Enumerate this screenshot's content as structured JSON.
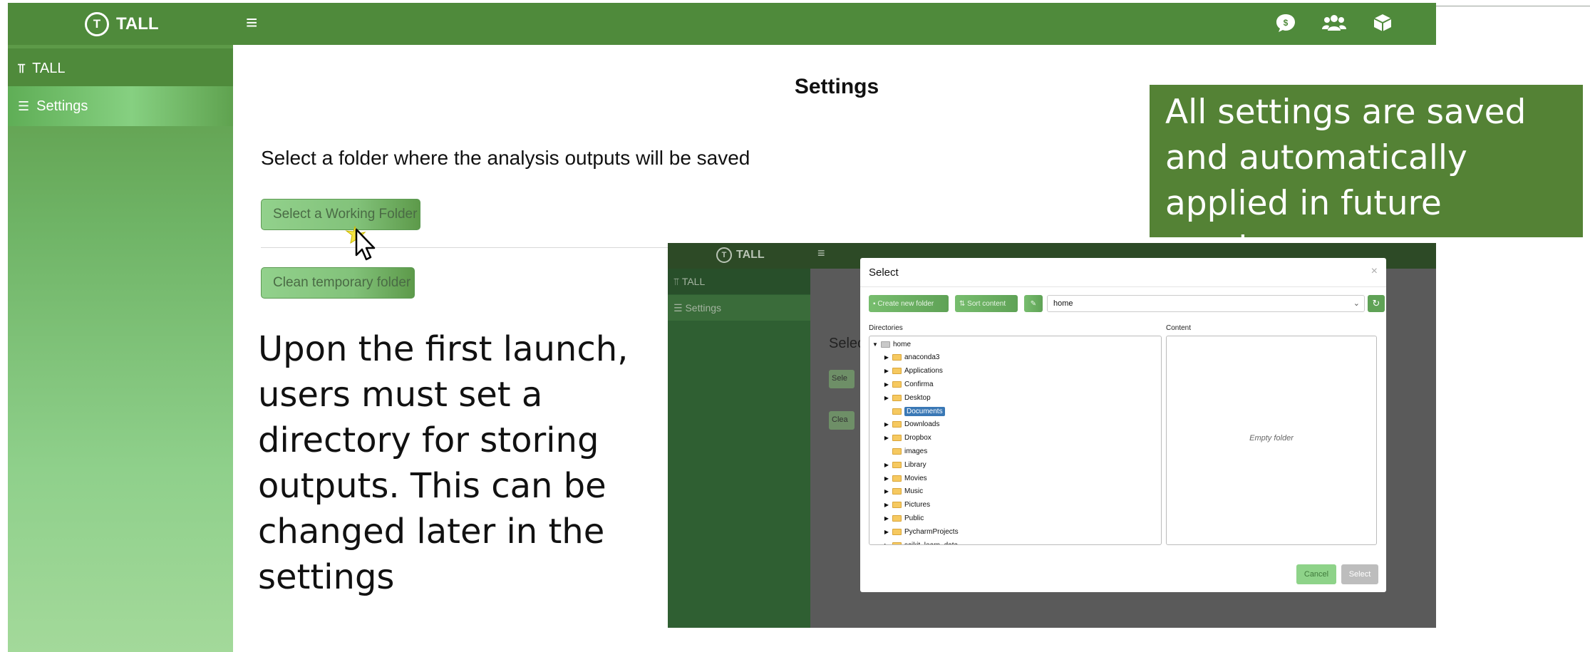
{
  "app": {
    "name": "TALL"
  },
  "header": {
    "menu_icon": "hamburger-icon",
    "right_icons": [
      "chat-dollar-icon",
      "users-icon",
      "cube-icon"
    ]
  },
  "sidebar": {
    "items": [
      {
        "label": "TALL",
        "icon": "tall-icon"
      },
      {
        "label": "Settings",
        "icon": "list-settings-icon"
      }
    ]
  },
  "main": {
    "title": "Settings",
    "instruction": "Select a folder where the analysis outputs will be saved",
    "working_folder_button": "Select a Working Folder",
    "clean_button": "Clean temporary folder"
  },
  "annotations": {
    "caption": "Upon the first launch, users must set a directory for storing outputs. This can be changed later in the settings",
    "note": "All settings are saved and automatically applied in future sessions"
  },
  "inset": {
    "brand": "TALL",
    "sidebar_items": [
      "TALL",
      "Settings"
    ],
    "main_fragment": "Selec",
    "fragment_buttons": [
      "Sele",
      "Clea"
    ],
    "modal": {
      "title": "Select",
      "close": "×",
      "create_folder": "Create new folder",
      "sort_content": "Sort content",
      "path": "home",
      "directories_label": "Directories",
      "content_label": "Content",
      "empty": "Empty folder",
      "root": "home",
      "folders": [
        "anaconda3",
        "Applications",
        "Confirma",
        "Desktop",
        "Documents",
        "Downloads",
        "Dropbox",
        "images",
        "Library",
        "Movies",
        "Music",
        "Pictures",
        "Public",
        "PycharmProjects",
        "scikit_learn_data"
      ],
      "selected_folder": "Documents",
      "cancel": "Cancel",
      "select": "Select"
    }
  },
  "colors": {
    "header": "#4f8a3b",
    "note_box": "#548235",
    "accent": "#5fa256"
  }
}
